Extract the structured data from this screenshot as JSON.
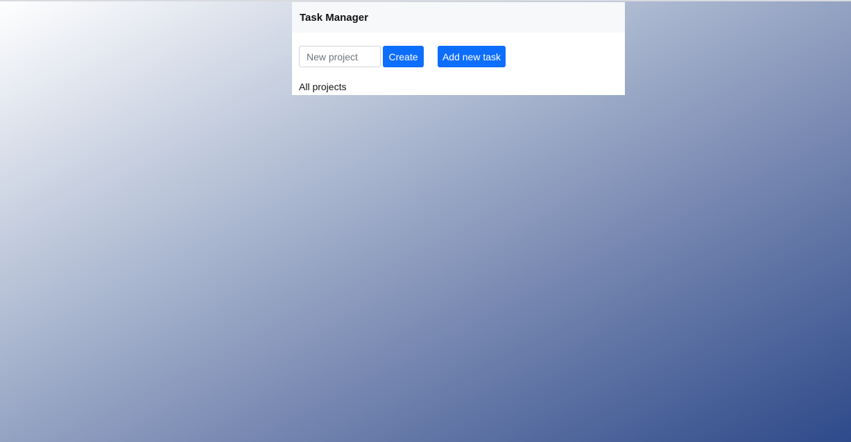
{
  "header": {
    "title": "Task Manager"
  },
  "project_form": {
    "placeholder": "New project",
    "value": "",
    "create_label": "Create"
  },
  "toolbar": {
    "add_task_label": "Add new task"
  },
  "projects": {
    "heading": "All projects"
  },
  "colors": {
    "accent": "#0d6efd",
    "background_start": "#ffffff",
    "background_end": "#2e4a8a"
  }
}
